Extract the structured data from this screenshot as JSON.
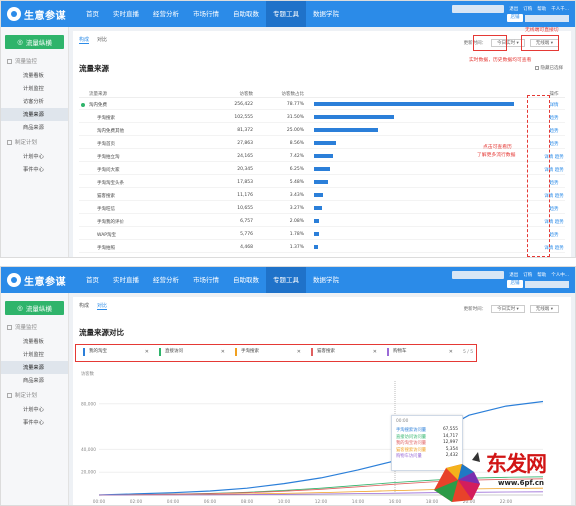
{
  "brand": {
    "name": "生意参谋"
  },
  "nav": [
    "首页",
    "实时直播",
    "经营分析",
    "市场行情",
    "自助取数",
    "专题工具",
    "数据学院"
  ],
  "nav_active_index": 5,
  "topbar": {
    "links": [
      "退出",
      "订购",
      "帮助",
      "千人千..."
    ],
    "link_short": [
      "退出",
      "订购",
      "帮助",
      "个人中..."
    ],
    "button": "店铺"
  },
  "sidebar": {
    "header": "流量纵横",
    "groups": [
      {
        "label": "流量监控",
        "items": [
          "流量看板",
          "计划监控",
          "访客分析",
          "流量来源",
          "商品来源"
        ]
      },
      {
        "label": "制定计划",
        "items": [
          "计划中心",
          "事件中心"
        ]
      }
    ],
    "active_item": "流量来源"
  },
  "sidebar2": {
    "header": "流量纵横",
    "groups": [
      {
        "label": "流量监控",
        "items": [
          "流量看板",
          "计划监控",
          "流量来源",
          "商品来源"
        ]
      },
      {
        "label": "制定计划",
        "items": [
          "计划中心",
          "事件中心"
        ]
      }
    ],
    "active_item": "流量来源"
  },
  "tabs": [
    "构成",
    "对比"
  ],
  "panel1": {
    "active_tab": 0,
    "update_label": "更新时间：",
    "time_select": "今日实时",
    "device_select": "无线端",
    "annotation_top": "无线端可直接切",
    "annotation_top2": "实时数据，历史数据均可查看",
    "section_title": "流量来源",
    "checkbox_label": "隐藏已选择",
    "columns": [
      "流量来源",
      "访客数",
      "访客数占比",
      "操作"
    ],
    "rows": [
      {
        "name": "淘内免费",
        "visitors": "256,422",
        "pct": "78.77%",
        "ratio": 0.7877,
        "ops": "详情",
        "top": true
      },
      {
        "name": "手淘搜索",
        "visitors": "102,555",
        "pct": "31.50%",
        "ratio": 0.315,
        "ops": "趋势"
      },
      {
        "name": "淘内免费其他",
        "visitors": "81,372",
        "pct": "25.00%",
        "ratio": 0.25,
        "ops": "趋势"
      },
      {
        "name": "手淘首页",
        "visitors": "27,863",
        "pct": "8.56%",
        "ratio": 0.0856,
        "ops": "趋势"
      },
      {
        "name": "手淘拍立淘",
        "visitors": "24,165",
        "pct": "7.42%",
        "ratio": 0.0742,
        "ops": "详情 趋势"
      },
      {
        "name": "手淘问大家",
        "visitors": "20,345",
        "pct": "6.25%",
        "ratio": 0.0625,
        "ops": "详情 趋势"
      },
      {
        "name": "手淘淘宝头条",
        "visitors": "17,853",
        "pct": "5.48%",
        "ratio": 0.0548,
        "ops": "趋势"
      },
      {
        "name": "猫客搜索",
        "visitors": "11,176",
        "pct": "3.43%",
        "ratio": 0.0343,
        "ops": "详情 趋势"
      },
      {
        "name": "手淘旺信",
        "visitors": "10,655",
        "pct": "3.27%",
        "ratio": 0.0327,
        "ops": "趋势"
      },
      {
        "name": "手淘我的评价",
        "visitors": "6,757",
        "pct": "2.08%",
        "ratio": 0.0208,
        "ops": "详情 趋势"
      },
      {
        "name": "WAP淘宝",
        "visitors": "5,776",
        "pct": "1.78%",
        "ratio": 0.0178,
        "ops": "趋势"
      },
      {
        "name": "手淘拍照",
        "visitors": "4,468",
        "pct": "1.37%",
        "ratio": 0.0137,
        "ops": "详情 趋势"
      }
    ],
    "annotation_side": "点击可查看历",
    "annotation_side2": "了解更多流行数据"
  },
  "panel2": {
    "active_tab": 1,
    "update_label": "更新时间：",
    "time_select": "今日实时",
    "device_select": "无线端",
    "section_title": "流量来源对比",
    "metric_label": "访客数",
    "chips": [
      {
        "label": "我的淘宝",
        "color": "#2b7fd9"
      },
      {
        "label": "直接访问",
        "color": "#2fb46b"
      },
      {
        "label": "手淘搜索",
        "color": "#f0a020"
      },
      {
        "label": "猫客搜索",
        "color": "#e06060"
      },
      {
        "label": "购物车",
        "color": "#9a6bd6"
      }
    ],
    "chip_count": "5 / 5",
    "tooltip": {
      "title": "00:00",
      "rows": [
        {
          "label": "手淘搜索访问量",
          "value": "67,555",
          "color": "#2b7fd9"
        },
        {
          "label": "直接访问访问量",
          "value": "14,717",
          "color": "#2fb46b"
        },
        {
          "label": "我的淘宝访问量",
          "value": "12,997",
          "color": "#e06060"
        },
        {
          "label": "猫客搜索访问量",
          "value": "5,354",
          "color": "#f0a020"
        },
        {
          "label": "购物车访问量",
          "value": "2,432",
          "color": "#9a6bd6"
        }
      ]
    },
    "y_ticks": [
      "80,000",
      "40,000",
      "20,000"
    ],
    "x_ticks": [
      "00:00",
      "02:00",
      "04:00",
      "06:00",
      "08:00",
      "10:00",
      "12:00",
      "14:00",
      "16:00",
      "18:00",
      "20:00",
      "22:00"
    ]
  },
  "chart_data": {
    "type": "line",
    "x": [
      "00:00",
      "02:00",
      "04:00",
      "06:00",
      "08:00",
      "10:00",
      "12:00",
      "14:00",
      "16:00",
      "18:00",
      "20:00",
      "22:00",
      "24:00"
    ],
    "ylabel": "访客数",
    "ylim": [
      0,
      100000
    ],
    "series": [
      {
        "name": "手淘搜索",
        "color": "#2b7fd9",
        "values": [
          0,
          1000,
          2000,
          3500,
          6000,
          10000,
          15000,
          22000,
          30000,
          52000,
          70000,
          78000,
          82000
        ]
      },
      {
        "name": "直接访问",
        "color": "#2fb46b",
        "values": [
          0,
          400,
          800,
          1400,
          2400,
          4000,
          6000,
          8500,
          11000,
          13000,
          14700,
          15500,
          16000
        ]
      },
      {
        "name": "我的淘宝",
        "color": "#e06060",
        "values": [
          0,
          300,
          700,
          1200,
          2000,
          3300,
          5000,
          7200,
          9500,
          11500,
          13000,
          13800,
          14200
        ]
      },
      {
        "name": "猫客搜索",
        "color": "#f0a020",
        "values": [
          0,
          150,
          300,
          500,
          900,
          1400,
          2100,
          3000,
          3900,
          4700,
          5300,
          5700,
          6000
        ]
      },
      {
        "name": "购物车",
        "color": "#9a6bd6",
        "values": [
          0,
          60,
          120,
          200,
          350,
          550,
          850,
          1200,
          1600,
          2000,
          2400,
          2600,
          2800
        ]
      }
    ]
  },
  "watermark": {
    "text": "东发网",
    "url": "www.6pf.cn"
  }
}
